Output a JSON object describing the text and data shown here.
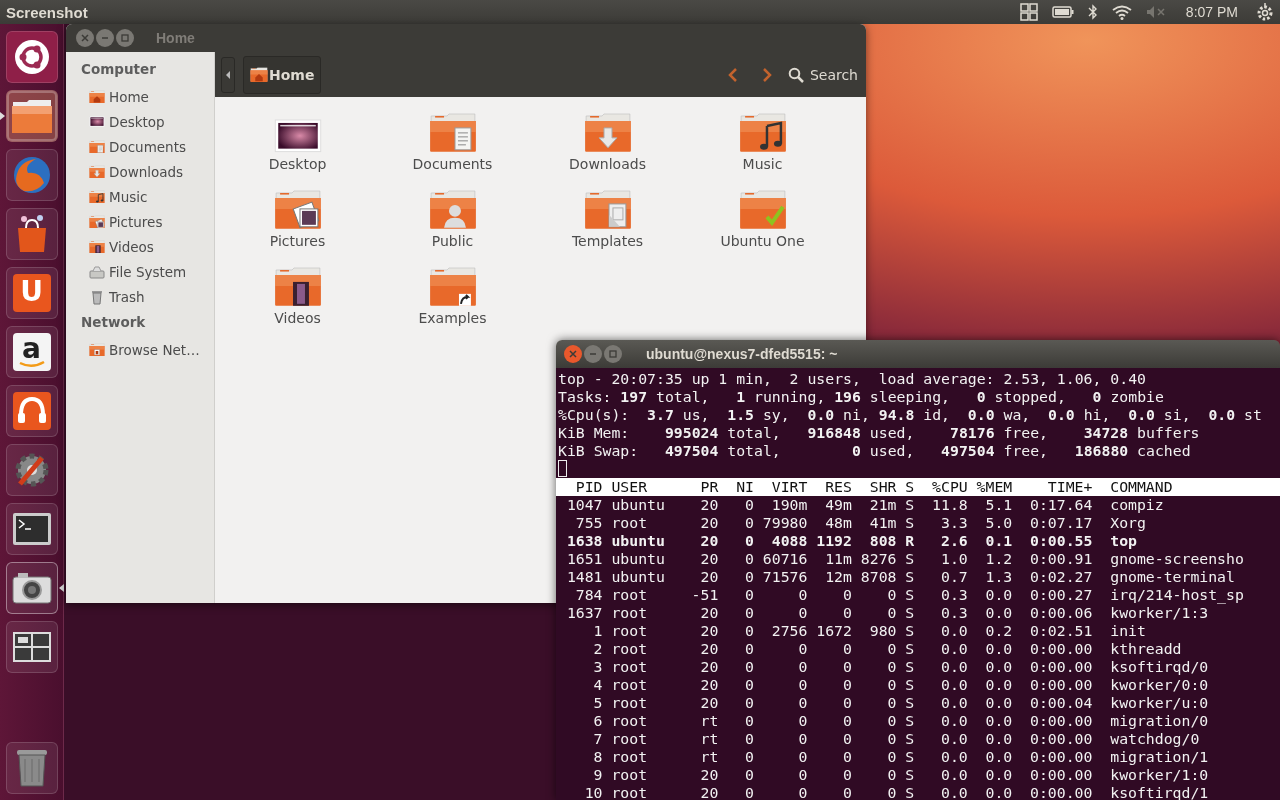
{
  "top_panel": {
    "app_title": "Screenshot",
    "clock": "8:07 PM"
  },
  "launcher": [
    {
      "kind": "dash",
      "running": false,
      "focused": false
    },
    {
      "kind": "files",
      "running": true,
      "focused": false
    },
    {
      "kind": "browser",
      "running": false,
      "focused": false
    },
    {
      "kind": "store",
      "running": false,
      "focused": false
    },
    {
      "kind": "cloud",
      "glyph": "U",
      "running": false,
      "focused": false
    },
    {
      "kind": "shop",
      "glyph": "a",
      "running": false,
      "focused": false
    },
    {
      "kind": "music",
      "running": false,
      "focused": false
    },
    {
      "kind": "settings",
      "running": false,
      "focused": false
    },
    {
      "kind": "terminal",
      "running": false,
      "focused": false
    },
    {
      "kind": "camera",
      "running": false,
      "focused": true
    },
    {
      "kind": "workspaces",
      "running": false,
      "focused": false
    },
    {
      "kind": "trash",
      "running": false,
      "focused": false
    }
  ],
  "file_manager": {
    "title": "Home",
    "path_button": "Home",
    "search": "Search",
    "sidebar": [
      {
        "heading": "Computer",
        "items": [
          {
            "label": "Home",
            "kind": "home"
          },
          {
            "label": "Desktop",
            "kind": "desktop"
          },
          {
            "label": "Documents",
            "kind": "documents"
          },
          {
            "label": "Downloads",
            "kind": "downloads"
          },
          {
            "label": "Music",
            "kind": "music"
          },
          {
            "label": "Pictures",
            "kind": "pictures"
          },
          {
            "label": "Videos",
            "kind": "videos"
          },
          {
            "label": "File System",
            "kind": "drive"
          },
          {
            "label": "Trash",
            "kind": "trash"
          }
        ]
      },
      {
        "heading": "Network",
        "items": [
          {
            "label": "Browse Net…",
            "kind": "network"
          }
        ]
      }
    ],
    "items": [
      {
        "label": "Desktop",
        "kind": "desktop"
      },
      {
        "label": "Documents",
        "kind": "documents"
      },
      {
        "label": "Downloads",
        "kind": "downloads"
      },
      {
        "label": "Music",
        "kind": "music"
      },
      {
        "label": "Pictures",
        "kind": "pictures"
      },
      {
        "label": "Public",
        "kind": "public"
      },
      {
        "label": "Templates",
        "kind": "templates"
      },
      {
        "label": "Ubuntu One",
        "kind": "synced"
      },
      {
        "label": "Videos",
        "kind": "videos"
      },
      {
        "label": "Examples",
        "kind": "link"
      }
    ]
  },
  "terminal": {
    "title": "ubuntu@nexus7-dfed5515: ~",
    "summary": [
      "top - 20:07:35 up 1 min,  2 users,  load average: 2.53, 1.06, 0.40",
      "Tasks: **197** total,   **1** running, **196** sleeping,   **0** stopped,   **0** zombie",
      "%Cpu(s):  **3.7** us,  **1.5** sy,  **0.0** ni, **94.8** id,  **0.0** wa,  **0.0** hi,  **0.0** si,  **0.0** st",
      "KiB Mem:    **995024** total,   **916848** used,    **78176** free,    **34728** buffers",
      "KiB Swap:   **497504** total,        **0** used,   **497504** free,   **186880** cached"
    ],
    "columns": [
      "PID",
      "USER",
      "PR",
      "NI",
      "VIRT",
      "RES",
      "SHR",
      "S",
      "%CPU",
      "%MEM",
      "TIME+",
      "COMMAND"
    ],
    "rows": [
      {
        "highlighted": false,
        "cells": [
          "1047",
          "ubuntu",
          "20",
          "0",
          "190m",
          "49m",
          "21m",
          "S",
          "11.8",
          "5.1",
          "0:17.64",
          "compiz"
        ]
      },
      {
        "highlighted": false,
        "cells": [
          "755",
          "root",
          "20",
          "0",
          "79980",
          "48m",
          "41m",
          "S",
          "3.3",
          "5.0",
          "0:07.17",
          "Xorg"
        ]
      },
      {
        "highlighted": true,
        "cells": [
          "1638",
          "ubuntu",
          "20",
          "0",
          "4088",
          "1192",
          "808",
          "R",
          "2.6",
          "0.1",
          "0:00.55",
          "top"
        ]
      },
      {
        "highlighted": false,
        "cells": [
          "1651",
          "ubuntu",
          "20",
          "0",
          "60716",
          "11m",
          "8276",
          "S",
          "1.0",
          "1.2",
          "0:00.91",
          "gnome-screensho"
        ]
      },
      {
        "highlighted": false,
        "cells": [
          "1481",
          "ubuntu",
          "20",
          "0",
          "71576",
          "12m",
          "8708",
          "S",
          "0.7",
          "1.3",
          "0:02.27",
          "gnome-terminal"
        ]
      },
      {
        "highlighted": false,
        "cells": [
          "784",
          "root",
          "-51",
          "0",
          "0",
          "0",
          "0",
          "S",
          "0.3",
          "0.0",
          "0:00.27",
          "irq/214-host_sp"
        ]
      },
      {
        "highlighted": false,
        "cells": [
          "1637",
          "root",
          "20",
          "0",
          "0",
          "0",
          "0",
          "S",
          "0.3",
          "0.0",
          "0:00.06",
          "kworker/1:3"
        ]
      },
      {
        "highlighted": false,
        "cells": [
          "1",
          "root",
          "20",
          "0",
          "2756",
          "1672",
          "980",
          "S",
          "0.0",
          "0.2",
          "0:02.51",
          "init"
        ]
      },
      {
        "highlighted": false,
        "cells": [
          "2",
          "root",
          "20",
          "0",
          "0",
          "0",
          "0",
          "S",
          "0.0",
          "0.0",
          "0:00.00",
          "kthreadd"
        ]
      },
      {
        "highlighted": false,
        "cells": [
          "3",
          "root",
          "20",
          "0",
          "0",
          "0",
          "0",
          "S",
          "0.0",
          "0.0",
          "0:00.00",
          "ksoftirqd/0"
        ]
      },
      {
        "highlighted": false,
        "cells": [
          "4",
          "root",
          "20",
          "0",
          "0",
          "0",
          "0",
          "S",
          "0.0",
          "0.0",
          "0:00.00",
          "kworker/0:0"
        ]
      },
      {
        "highlighted": false,
        "cells": [
          "5",
          "root",
          "20",
          "0",
          "0",
          "0",
          "0",
          "S",
          "0.0",
          "0.0",
          "0:00.04",
          "kworker/u:0"
        ]
      },
      {
        "highlighted": false,
        "cells": [
          "6",
          "root",
          "rt",
          "0",
          "0",
          "0",
          "0",
          "S",
          "0.0",
          "0.0",
          "0:00.00",
          "migration/0"
        ]
      },
      {
        "highlighted": false,
        "cells": [
          "7",
          "root",
          "rt",
          "0",
          "0",
          "0",
          "0",
          "S",
          "0.0",
          "0.0",
          "0:00.00",
          "watchdog/0"
        ]
      },
      {
        "highlighted": false,
        "cells": [
          "8",
          "root",
          "rt",
          "0",
          "0",
          "0",
          "0",
          "S",
          "0.0",
          "0.0",
          "0:00.00",
          "migration/1"
        ]
      },
      {
        "highlighted": false,
        "cells": [
          "9",
          "root",
          "20",
          "0",
          "0",
          "0",
          "0",
          "S",
          "0.0",
          "0.0",
          "0:00.00",
          "kworker/1:0"
        ]
      },
      {
        "highlighted": false,
        "cells": [
          "10",
          "root",
          "20",
          "0",
          "0",
          "0",
          "0",
          "S",
          "0.0",
          "0.0",
          "0:00.00",
          "ksoftirqd/1"
        ]
      }
    ]
  }
}
